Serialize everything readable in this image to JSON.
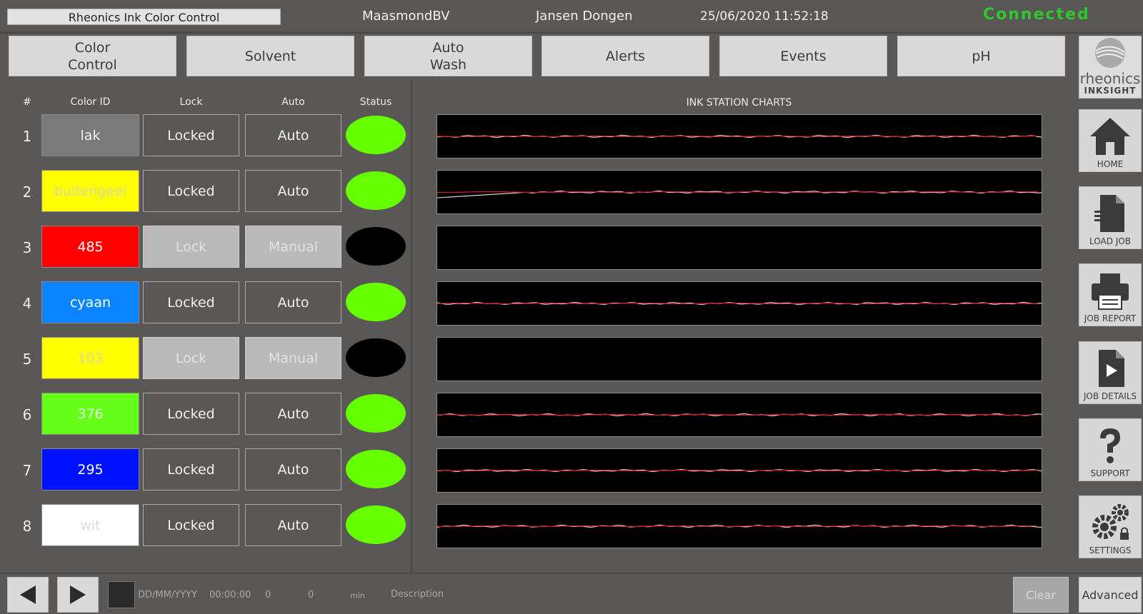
{
  "header": {
    "app_title": "Rheonics Ink Color Control",
    "company": "MaasmondBV",
    "user": "Jansen Dongen",
    "datetime": "25/06/2020 11:52:18",
    "connection_status": "Connected"
  },
  "tabs": [
    {
      "label": "Color\nControl"
    },
    {
      "label": "Solvent"
    },
    {
      "label": "Auto\nWash"
    },
    {
      "label": "Alerts"
    },
    {
      "label": "Events"
    },
    {
      "label": "pH"
    }
  ],
  "grid": {
    "headers": {
      "num": "#",
      "color_id": "Color ID",
      "lock": "Lock",
      "auto": "Auto",
      "status": "Status"
    },
    "rows": [
      {
        "num": "1",
        "color_id": "lak",
        "color": "#7a7a7a",
        "text_color": "#f2f2f2",
        "lock": "Locked",
        "lock_active": true,
        "auto": "Auto",
        "auto_active": true,
        "status_color": "#66ff00"
      },
      {
        "num": "2",
        "color_id": "buitengeel",
        "color": "#ffff00",
        "text_color": "#d8d8a0",
        "lock": "Locked",
        "lock_active": true,
        "auto": "Auto",
        "auto_active": true,
        "status_color": "#66ff00"
      },
      {
        "num": "3",
        "color_id": "485",
        "color": "#ff0000",
        "text_color": "#ffffff",
        "lock": "Lock",
        "lock_active": false,
        "auto": "Manual",
        "auto_active": false,
        "status_color": "#000000"
      },
      {
        "num": "4",
        "color_id": "cyaan",
        "color": "#0a84ff",
        "text_color": "#ffffff",
        "lock": "Locked",
        "lock_active": true,
        "auto": "Auto",
        "auto_active": true,
        "status_color": "#66ff00"
      },
      {
        "num": "5",
        "color_id": "103",
        "color": "#ffff00",
        "text_color": "#d8d8a0",
        "lock": "Lock",
        "lock_active": false,
        "auto": "Manual",
        "auto_active": false,
        "status_color": "#000000"
      },
      {
        "num": "6",
        "color_id": "376",
        "color": "#66ff1a",
        "text_color": "#e6ffe0",
        "lock": "Locked",
        "lock_active": true,
        "auto": "Auto",
        "auto_active": true,
        "status_color": "#66ff00"
      },
      {
        "num": "7",
        "color_id": "295",
        "color": "#0011ff",
        "text_color": "#ffffff",
        "lock": "Locked",
        "lock_active": true,
        "auto": "Auto",
        "auto_active": true,
        "status_color": "#66ff00"
      },
      {
        "num": "8",
        "color_id": "wit",
        "color": "#ffffff",
        "text_color": "#dcdcdc",
        "lock": "Locked",
        "lock_active": true,
        "auto": "Auto",
        "auto_active": true,
        "status_color": "#66ff00"
      }
    ]
  },
  "charts": {
    "title": "INK STATION CHARTS",
    "stations": [
      {
        "active": true
      },
      {
        "active": true
      },
      {
        "active": false
      },
      {
        "active": true
      },
      {
        "active": false
      },
      {
        "active": true
      },
      {
        "active": true
      },
      {
        "active": true
      }
    ]
  },
  "sidebar": {
    "logo_word": "rheonics",
    "logo_sub": "INKSIGHT",
    "items": [
      {
        "label": "HOME",
        "icon": "home-icon"
      },
      {
        "label": "LOAD JOB",
        "icon": "document-icon"
      },
      {
        "label": "JOB REPORT",
        "icon": "printer-icon"
      },
      {
        "label": "JOB DETAILS",
        "icon": "play-document-icon"
      },
      {
        "label": "SUPPORT",
        "icon": "question-icon"
      },
      {
        "label": "SETTINGS",
        "icon": "gears-lock-icon"
      }
    ]
  },
  "footer": {
    "date_placeholder": "DD/MM/YYYY",
    "time_placeholder": "00:00:00",
    "value1": "0",
    "value2": "0",
    "unit": "min",
    "description": "Description",
    "clear_label": "Clear",
    "advanced_label": "Advanced"
  }
}
